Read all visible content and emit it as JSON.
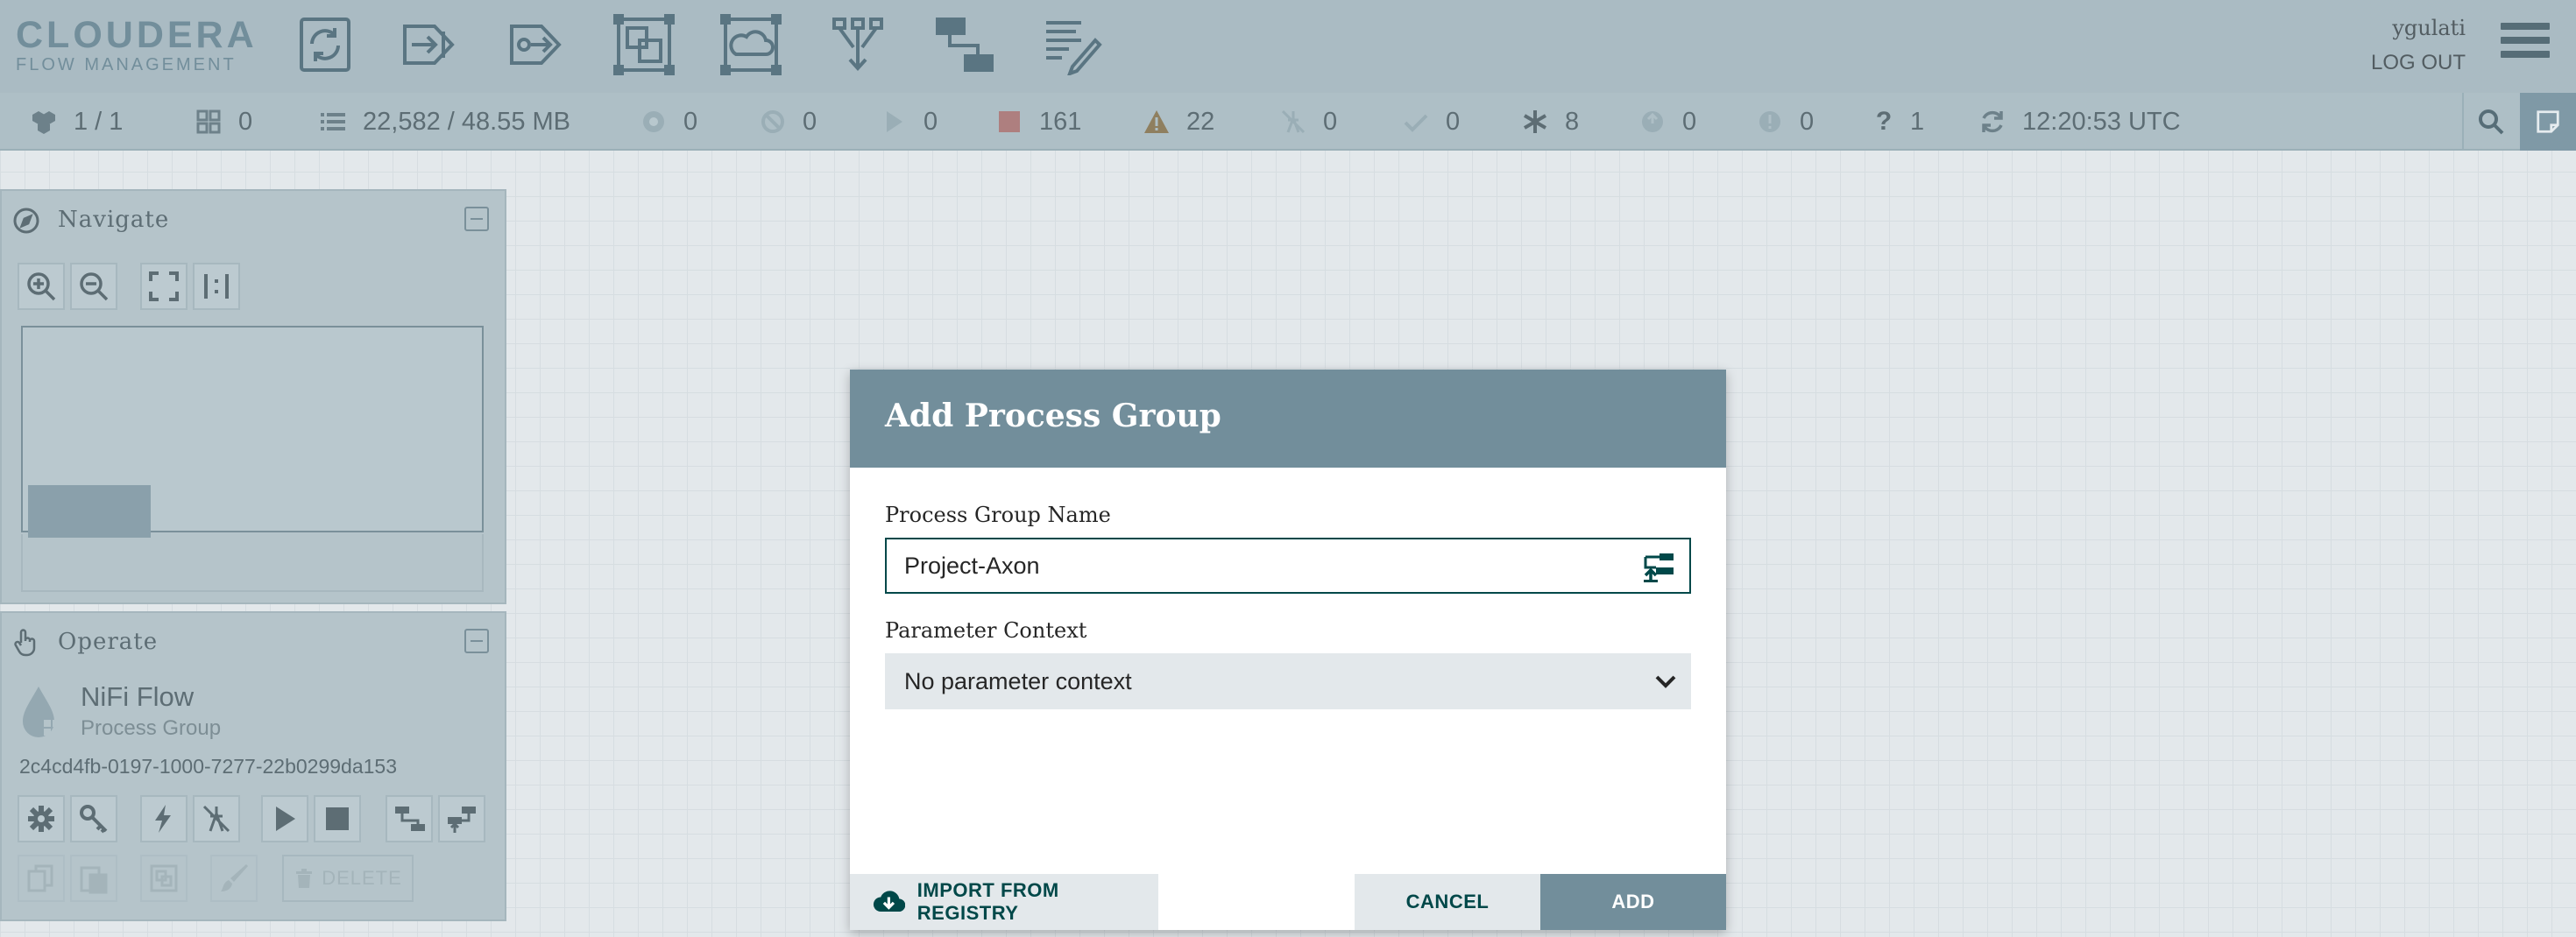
{
  "brand": {
    "line1": "CLOUDERA",
    "line2": "FLOW MANAGEMENT"
  },
  "toolbar": {
    "items": [
      {
        "name": "processor-icon"
      },
      {
        "name": "input-port-icon"
      },
      {
        "name": "output-port-icon"
      },
      {
        "name": "process-group-icon"
      },
      {
        "name": "remote-process-group-icon"
      },
      {
        "name": "funnel-icon"
      },
      {
        "name": "template-icon"
      },
      {
        "name": "label-icon"
      }
    ]
  },
  "user": {
    "name": "ygulati",
    "logout_label": "LOG OUT"
  },
  "status": {
    "cluster": "1 / 1",
    "transmitting": "0",
    "queued": "22,582 / 48.55 MB",
    "transmitting_rpg": "0",
    "not_transmitting_rpg": "0",
    "running": "0",
    "stopped": "161",
    "invalid": "22",
    "disabled": "0",
    "up_to_date": "0",
    "locally_modified": "8",
    "stale": "0",
    "locally_modified_stale": "0",
    "sync_failure": "1",
    "last_refreshed": "12:20:53 UTC"
  },
  "navigate": {
    "title": "Navigate"
  },
  "operate": {
    "title": "Operate",
    "flow_name": "NiFi Flow",
    "flow_type": "Process Group",
    "flow_id": "2c4cd4fb-0197-1000-7277-22b0299da153",
    "delete_label": "DELETE"
  },
  "dialog": {
    "title": "Add Process Group",
    "name_label": "Process Group Name",
    "name_value": "Project-Axon",
    "param_label": "Parameter Context",
    "param_value": "No parameter context",
    "import_label": "IMPORT FROM REGISTRY",
    "cancel_label": "CANCEL",
    "add_label": "ADD"
  },
  "colors": {
    "header": "#aabbc3",
    "accent": "#728e9b",
    "input_border": "#004849",
    "button_text": "#004849"
  }
}
